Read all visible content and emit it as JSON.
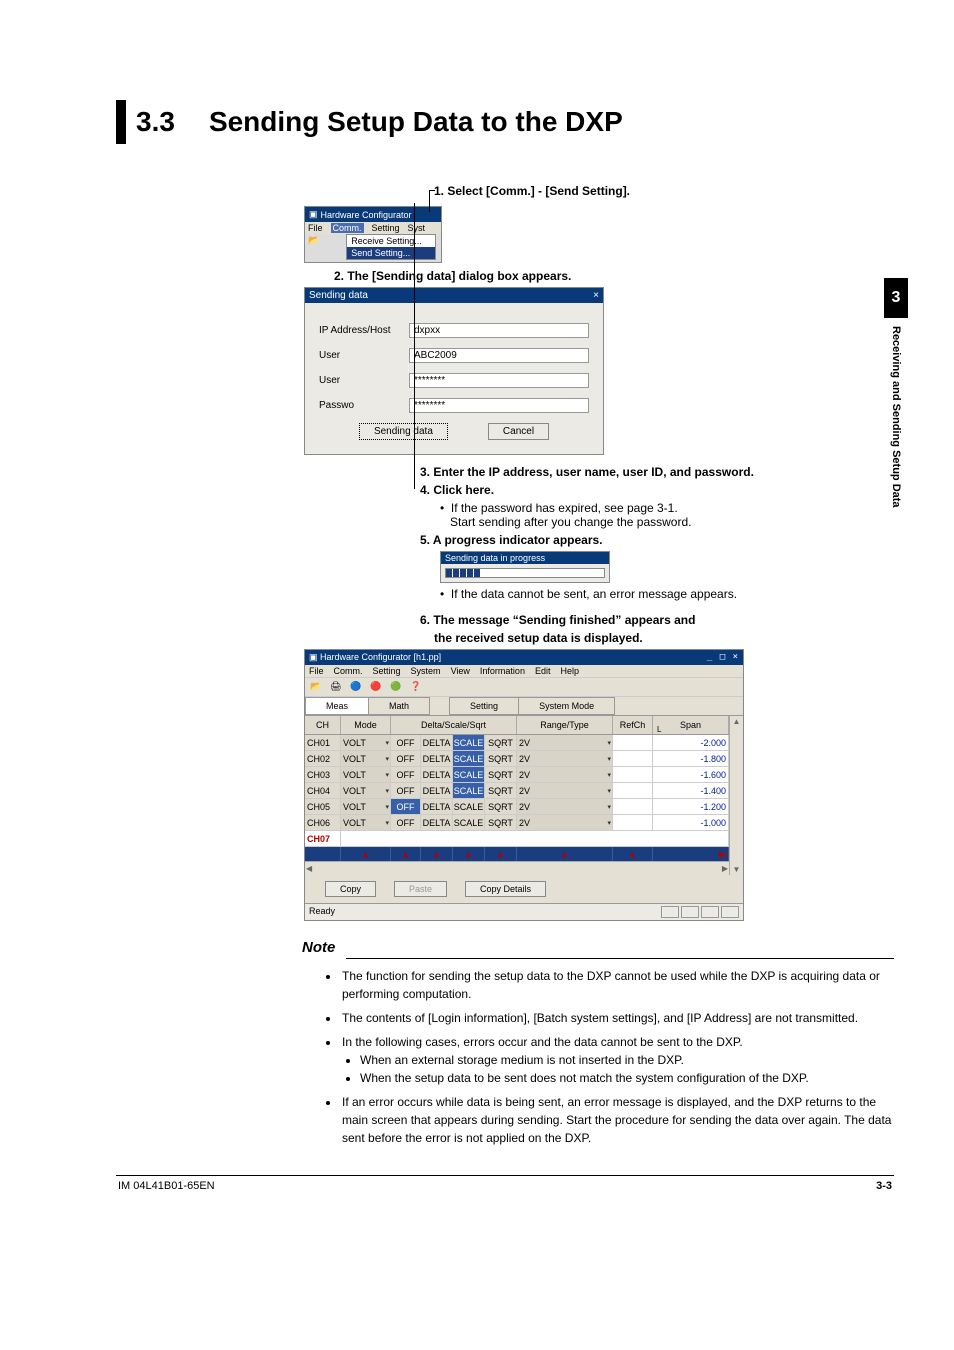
{
  "sidetab": {
    "number": "3",
    "title": "Receiving and Sending Setup Data"
  },
  "heading": {
    "number": "3.3",
    "title": "Sending Setup Data to the DXP"
  },
  "steps": {
    "s1": "1. Select [Comm.] - [Send Setting].",
    "s2": "2. The [Sending data] dialog box appears.",
    "s3": "3. Enter the IP address, user name, user ID, and password.",
    "s4": "4. Click here.",
    "s4a": "If the password has expired, see page 3-1.",
    "s4b": "Start sending after you change the password.",
    "s5": "5. A progress indicator appears.",
    "s5a": "If the data cannot be sent, an error message appears.",
    "s6": "6. The message “Sending finished” appears and",
    "s6b": "the received setup data is displayed."
  },
  "menu_shot": {
    "title": "Hardware Configurator",
    "items": [
      "File",
      "Comm.",
      "Setting",
      "Syst"
    ],
    "drop": [
      "Receive Setting...",
      "Send Setting..."
    ],
    "open_icon": "📂"
  },
  "dialog": {
    "title": "Sending data",
    "close": "×",
    "rows": [
      {
        "label": "IP Address/Host",
        "value": "dxpxx"
      },
      {
        "label": "User",
        "value": "ABC2009"
      },
      {
        "label": "User",
        "value": "********"
      },
      {
        "label": "Passwo",
        "value": "********"
      }
    ],
    "ok": "Sending data",
    "cancel": "Cancel"
  },
  "progress": {
    "title": "Sending data in progress"
  },
  "app": {
    "title": "Hardware Configurator [h1.pp]",
    "winctl": "_ □ ×",
    "menubar": [
      "File",
      "Comm.",
      "Setting",
      "System",
      "View",
      "Information",
      "Edit",
      "Help"
    ],
    "tool_icons": [
      "📂",
      "🖨",
      "🔵",
      "🔴",
      "🟢",
      "❓"
    ],
    "tabs": {
      "t1": "Meas",
      "t2": "Math",
      "t3": "Setting",
      "t4": "System Mode"
    },
    "headers": {
      "ch": "CH",
      "mode": "Mode",
      "dss": "Delta/Scale/Sqrt",
      "range": "Range/Type",
      "ref": "RefCh",
      "spanL": "Span",
      "L": "L"
    },
    "rows": [
      {
        "ch": "CH01",
        "mode": "VOLT",
        "c1": "OFF",
        "c2": "DELTA",
        "c3": "SCALE",
        "c4": "SQRT",
        "range": "2V",
        "span": "-2.000"
      },
      {
        "ch": "CH02",
        "mode": "VOLT",
        "c1": "OFF",
        "c2": "DELTA",
        "c3": "SCALE",
        "c4": "SQRT",
        "range": "2V",
        "span": "-1.800"
      },
      {
        "ch": "CH03",
        "mode": "VOLT",
        "c1": "OFF",
        "c2": "DELTA",
        "c3": "SCALE",
        "c4": "SQRT",
        "range": "2V",
        "span": "-1.600"
      },
      {
        "ch": "CH04",
        "mode": "VOLT",
        "c1": "OFF",
        "c2": "DELTA",
        "c3": "SCALE",
        "c4": "SQRT",
        "range": "2V",
        "span": "-1.400"
      },
      {
        "ch": "CH05",
        "mode": "VOLT",
        "c1": "OFF",
        "c2": "DELTA",
        "c3": "SCALE",
        "c4": "SQRT",
        "range": "2V",
        "span": "-1.200"
      },
      {
        "ch": "CH06",
        "mode": "VOLT",
        "c1": "OFF",
        "c2": "DELTA",
        "c3": "SCALE",
        "c4": "SQRT",
        "range": "2V",
        "span": "-1.000"
      }
    ],
    "ch07": "CH07",
    "btns": {
      "copy": "Copy",
      "paste": "Paste",
      "details": "Copy Details"
    },
    "status": "Ready",
    "tri": "▲",
    "end": "▶|"
  },
  "note": {
    "heading": "Note",
    "b1": "The function for sending the setup data to the DXP cannot be used while the DXP is acquiring data or performing computation.",
    "b2": "The contents of [Login information], [Batch system settings], and  [IP Address] are not transmitted.",
    "b3": "In the following cases, errors occur and the data cannot be sent to the DXP.",
    "b3a": "When an external storage medium is not inserted in the DXP.",
    "b3b": "When the setup data to be sent does not match the system configuration of the DXP.",
    "b4": "If an error occurs while data is being sent, an error message is displayed, and the DXP returns to the main screen that appears during sending. Start the procedure for sending the data over again. The data sent before the error is not applied on the DXP."
  },
  "footer": {
    "left": "IM 04L41B01-65EN",
    "right": "3-3"
  }
}
